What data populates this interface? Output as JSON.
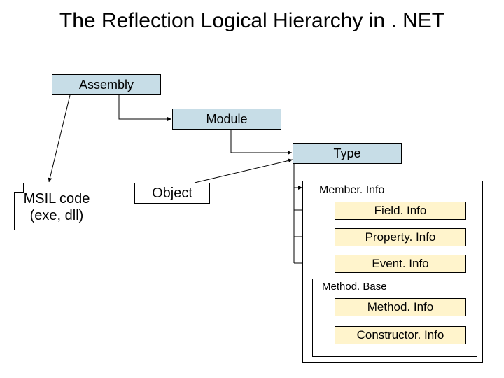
{
  "title": "The Reflection Logical Hierarchy in . NET",
  "boxes": {
    "assembly": "Assembly",
    "module": "Module",
    "type": "Type",
    "object": "Object",
    "msil_l1": "MSIL code",
    "msil_l2": "(exe, dll)",
    "memberinfo": "Member. Info",
    "fieldinfo": "Field. Info",
    "propertyinfo": "Property. Info",
    "eventinfo": "Event. Info",
    "methodbase": "Method. Base",
    "methodinfo": "Method. Info",
    "constructorinfo": "Constructor. Info"
  }
}
